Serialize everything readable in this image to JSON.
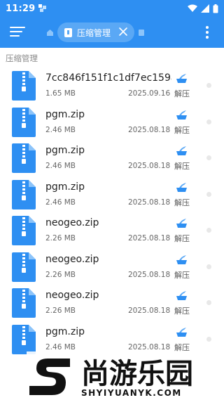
{
  "status_bar": {
    "time": "11:29"
  },
  "toolbar": {
    "menu_icon": "menu-icon",
    "tab_title": "压缩管理",
    "close_icon": "close-icon",
    "overflow_icon": "more-vert-icon"
  },
  "section": {
    "title": "压缩管理"
  },
  "files": [
    {
      "name": "7cc846f151f1c1df7ec159a...",
      "size": "1.65 MB",
      "date": "2025.09.16",
      "action": "解压"
    },
    {
      "name": "pgm.zip",
      "size": "2.46 MB",
      "date": "2025.08.18",
      "action": "解压"
    },
    {
      "name": "pgm.zip",
      "size": "2.46 MB",
      "date": "2025.08.18",
      "action": "解压"
    },
    {
      "name": "pgm.zip",
      "size": "2.46 MB",
      "date": "2025.08.18",
      "action": "解压"
    },
    {
      "name": "neogeo.zip",
      "size": "2.26 MB",
      "date": "2025.08.18",
      "action": "解压"
    },
    {
      "name": "neogeo.zip",
      "size": "2.26 MB",
      "date": "2025.08.18",
      "action": "解压"
    },
    {
      "name": "neogeo.zip",
      "size": "2.26 MB",
      "date": "2025.08.18",
      "action": "解压"
    },
    {
      "name": "pgm.zip",
      "size": "2.46 MB",
      "date": "2025.08.18",
      "action": "解压"
    }
  ],
  "watermark": {
    "brand": "尚游乐园",
    "url": "SHYIYUANYK.COM"
  },
  "colors": {
    "accent": "#2e8ff2",
    "file_icon": "#2e8ff2",
    "chip": "#5aa8f5"
  }
}
